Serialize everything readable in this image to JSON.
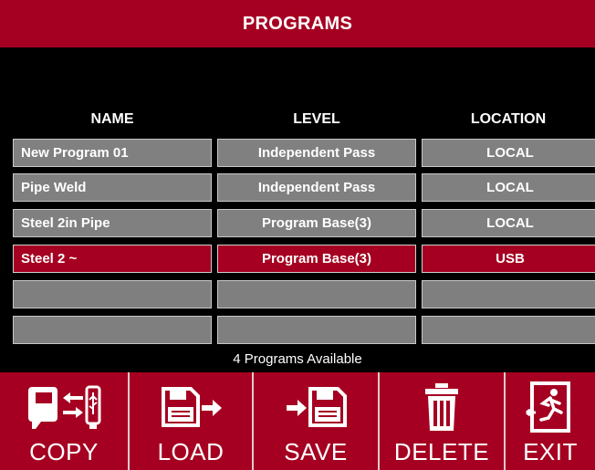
{
  "title": "PROGRAMS",
  "columns": {
    "name": "NAME",
    "level": "LEVEL",
    "location": "LOCATION"
  },
  "rows": [
    {
      "name": "New Program 01",
      "level": "Independent Pass",
      "location": "LOCAL",
      "selected": false
    },
    {
      "name": "Pipe Weld",
      "level": "Independent Pass",
      "location": "LOCAL",
      "selected": false
    },
    {
      "name": "Steel 2in Pipe",
      "level": "Program Base(3)",
      "location": "LOCAL",
      "selected": false
    },
    {
      "name": "Steel 2 ~",
      "level": "Program Base(3)",
      "location": "USB",
      "selected": true
    },
    {
      "name": "",
      "level": "",
      "location": "",
      "selected": false
    },
    {
      "name": "",
      "level": "",
      "location": "",
      "selected": false
    }
  ],
  "status": "4 Programs Available",
  "toolbar": {
    "copy": {
      "label": "COPY",
      "icon": "copy-usb-icon"
    },
    "load": {
      "label": "LOAD",
      "icon": "load-floppy-icon"
    },
    "save": {
      "label": "SAVE",
      "icon": "save-floppy-icon"
    },
    "delete": {
      "label": "DELETE",
      "icon": "trash-icon"
    },
    "exit": {
      "label": "EXIT",
      "icon": "exit-door-icon"
    }
  },
  "colors": {
    "accent": "#a50021",
    "cell": "#808080",
    "background": "#000000",
    "text": "#ffffff"
  }
}
